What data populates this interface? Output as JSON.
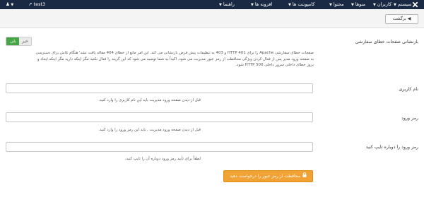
{
  "navbar": {
    "menu": [
      {
        "label": "سیستم",
        "name": "nav-system"
      },
      {
        "label": "کاربران",
        "name": "nav-users"
      },
      {
        "label": "منوها",
        "name": "nav-menus"
      },
      {
        "label": "محتوا",
        "name": "nav-content"
      },
      {
        "label": "کامپوننت ها",
        "name": "nav-components"
      },
      {
        "label": "افزونه ها",
        "name": "nav-extensions"
      },
      {
        "label": "راهنما",
        "name": "nav-help"
      }
    ],
    "site_name": "test3"
  },
  "toolbar": {
    "back_label": "برگشت"
  },
  "form": {
    "custom_error_label": "بازنشانی صفحات خطای سفارشی",
    "toggle_yes": "بلی",
    "toggle_no": "خیر",
    "description_lines": [
      "صفحات خطای سفارشی Apache را برای HTTP 401 و 403 به تنظیمات پیش فرض بازنشانی می کند. این امر مانع از خطای 404 مقاله یافت نشد' هنگام تلاش برای دسترسی",
      "به صفحه ورود مدیر پس از فعال کردن ویژگی محافظت از رمز عبور مدیریت می شود. اکیداً به شما توصیه می شود که این گزینه را فعال نکنید مگر اینکه دارید مگر اینکه ایجاد و",
      "بروز خطای داخلی سرور داخلی HTTP 500 شود."
    ],
    "username_label": "نام کاربری",
    "username_hint": "قبل از دیدن صفحه ورود مدیریت باید این نام کاربری را وارد کنید.",
    "password_label": "رمز ورود",
    "password_hint": "قبل از دیدن صفحه ورود مدیریت , باید این رمز ورود را وارد کنید.",
    "password2_label": "رمز ورود را دوباره تایپ کنید",
    "password2_hint": "لطفاً برای تأیید رمز ورود دوباره آن را تایپ کنید.",
    "submit_label": "محافظت از رمز عبور را درخواست دهید"
  }
}
